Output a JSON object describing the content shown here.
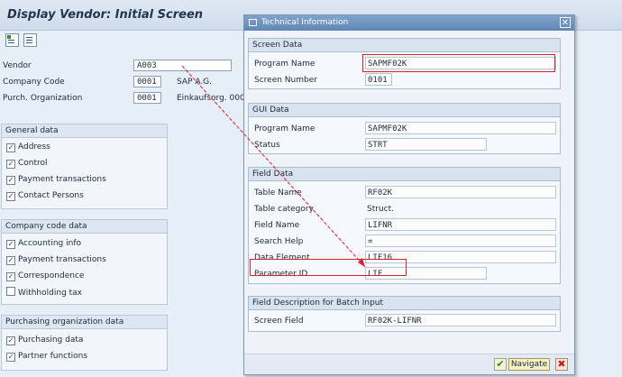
{
  "screen": {
    "title": "Display Vendor:  Initial Screen"
  },
  "form": {
    "vendor_label": "Vendor",
    "vendor_value": "A003",
    "company_code_label": "Company Code",
    "company_code_value": "0001",
    "company_code_desc": "SAP A.G.",
    "purch_org_label": "Purch. Organization",
    "purch_org_value": "0001",
    "purch_org_desc": "Einkaufsorg. 000"
  },
  "general_data": {
    "title": "General data",
    "items": [
      {
        "label": "Address",
        "checked": true
      },
      {
        "label": "Control",
        "checked": true
      },
      {
        "label": "Payment transactions",
        "checked": true
      },
      {
        "label": "Contact Persons",
        "checked": true
      }
    ]
  },
  "company_code_data": {
    "title": "Company code data",
    "items": [
      {
        "label": "Accounting info",
        "checked": true
      },
      {
        "label": "Payment transactions",
        "checked": true
      },
      {
        "label": "Correspondence",
        "checked": true
      },
      {
        "label": "Withholding tax",
        "checked": false
      }
    ]
  },
  "purchasing_org_data": {
    "title": "Purchasing organization data",
    "items": [
      {
        "label": "Purchasing data",
        "checked": true
      },
      {
        "label": "Partner functions",
        "checked": true
      }
    ]
  },
  "dialog": {
    "title": "Technical Information",
    "close_glyph": "✕",
    "screen_data": {
      "title": "Screen Data",
      "program_name_label": "Program Name",
      "program_name_value": "SAPMF02K",
      "screen_number_label": "Screen Number",
      "screen_number_value": "0101"
    },
    "gui_data": {
      "title": "GUI Data",
      "program_name_label": "Program Name",
      "program_name_value": "SAPMF02K",
      "status_label": "Status",
      "status_value": "STRT"
    },
    "field_data": {
      "title": "Field Data",
      "table_name_label": "Table Name",
      "table_name_value": "RF02K",
      "table_category_label": "Table category",
      "table_category_value": "Struct.",
      "field_name_label": "Field Name",
      "field_name_value": "LIFNR",
      "search_help_label": "Search Help",
      "search_help_value": "=",
      "data_element_label": "Data Element",
      "data_element_value": "LIF16",
      "parameter_id_label": "Parameter ID",
      "parameter_id_value": "LIF"
    },
    "batch_input": {
      "title": "Field Description for Batch Input",
      "screen_field_label": "Screen Field",
      "screen_field_value": "RF02K-LIFNR"
    },
    "buttons": {
      "ok_glyph": "✔",
      "navigate_label": "Navigate",
      "cancel_glyph": "✖"
    }
  },
  "colors": {
    "highlight": "#d9242a",
    "title_bar": "#5f86b6"
  }
}
